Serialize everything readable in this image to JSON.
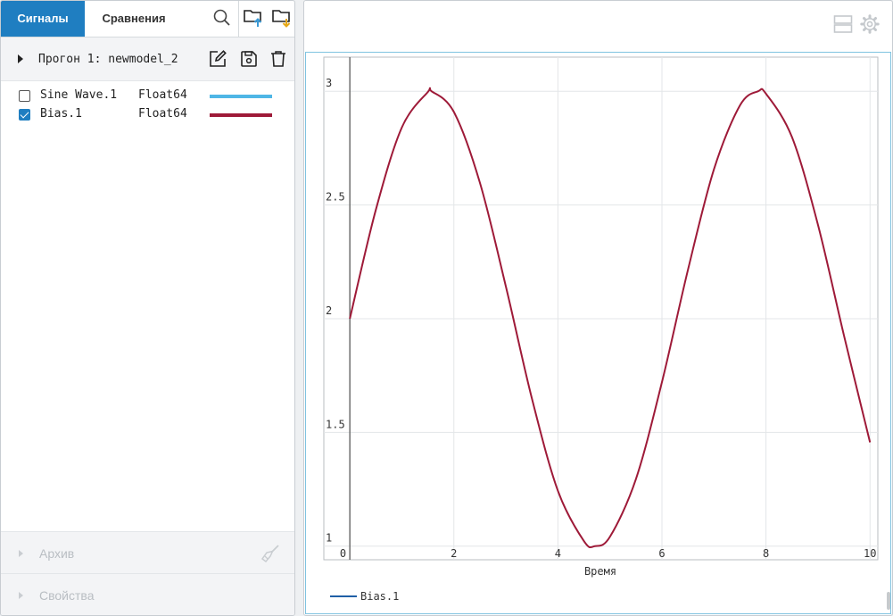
{
  "tabs": {
    "signals": "Сигналы",
    "compare": "Сравнения"
  },
  "toolbar": {
    "search_icon": "search-icon",
    "import_icon": "folder-import-icon",
    "export_icon": "folder-export-icon"
  },
  "run": {
    "label": "Прогон 1: newmodel_2"
  },
  "signals": [
    {
      "name": "Sine Wave.1",
      "type": "Float64",
      "checked": false,
      "color": "#4fb6e6"
    },
    {
      "name": "Bias.1",
      "type": "Float64",
      "checked": true,
      "color": "#9e1a38"
    }
  ],
  "sections": {
    "archive": "Архив",
    "properties": "Свойства"
  },
  "chart_data": {
    "type": "line",
    "xlabel": "Время",
    "ylabel": "",
    "xlim": [
      -0.5,
      10.15
    ],
    "ylim": [
      0.94,
      3.15
    ],
    "xticks": [
      "0",
      "2",
      "4",
      "6",
      "8",
      "10"
    ],
    "yticks": [
      "1",
      "1.5",
      "2",
      "2.5",
      "3"
    ],
    "grid": true,
    "legend": "bottom-left",
    "series": [
      {
        "name": "Bias.1",
        "color": "#9e1a38",
        "x": [
          0,
          0.5,
          1,
          1.5,
          1.57,
          2,
          2.5,
          3,
          3.5,
          4,
          4.5,
          4.71,
          5,
          5.5,
          6,
          6.5,
          7,
          7.5,
          7.85,
          8,
          8.5,
          9,
          9.5,
          10
        ],
        "y": [
          2,
          2.479,
          2.841,
          2.997,
          3,
          2.909,
          2.598,
          2.141,
          1.649,
          1.243,
          1.022,
          1,
          1.041,
          1.295,
          1.721,
          2.215,
          2.657,
          2.938,
          3,
          2.989,
          2.798,
          2.412,
          1.925,
          1.456
        ]
      }
    ]
  }
}
